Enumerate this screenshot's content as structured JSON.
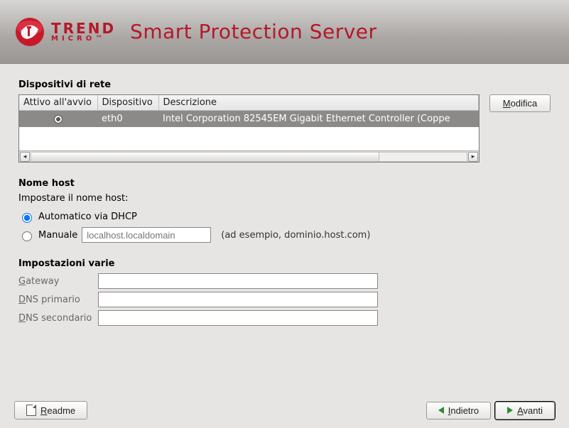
{
  "header": {
    "brand_top": "TREND",
    "brand_bottom": "MICRO",
    "title": "Smart Protection Server"
  },
  "devices": {
    "section_title": "Dispositivi di rete",
    "columns": {
      "active": "Attivo all'avvio",
      "device": "Dispositivo",
      "desc": "Descrizione"
    },
    "rows": [
      {
        "active": true,
        "device": "eth0",
        "desc": "Intel Corporation 82545EM Gigabit Ethernet Controller (Coppe"
      }
    ],
    "edit_button": "Modifica"
  },
  "hostname": {
    "section_title": "Nome host",
    "desc": "Impostare il nome host:",
    "auto_label": "Automatico via DHCP",
    "manual_label": "Manuale",
    "manual_placeholder": "localhost.localdomain",
    "manual_hint": "(ad esempio, dominio.host.com)",
    "selected": "auto"
  },
  "misc": {
    "section_title": "Impostazioni varie",
    "gateway_label": "Gateway",
    "dns1_label": "DNS primario",
    "dns2_label": "DNS secondario",
    "gateway": "",
    "dns1": "",
    "dns2": ""
  },
  "footer": {
    "readme": "Readme",
    "back": "Indietro",
    "next": "Avanti"
  }
}
